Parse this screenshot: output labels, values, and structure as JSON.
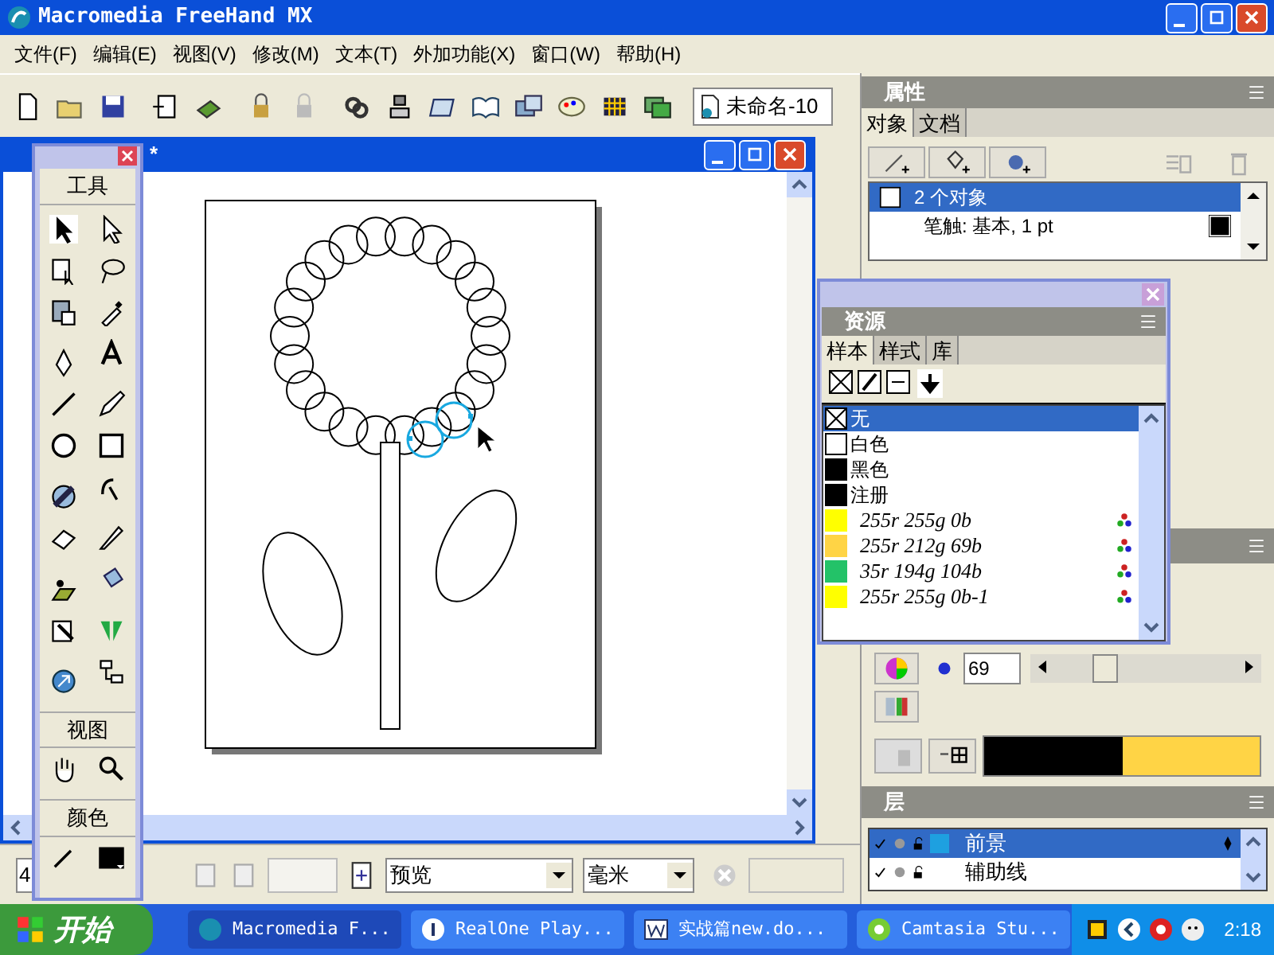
{
  "app": {
    "title": "Macromedia FreeHand MX"
  },
  "menu": [
    "文件(F)",
    "编辑(E)",
    "视图(V)",
    "修改(M)",
    "文本(T)",
    "外加功能(X)",
    "窗口(W)",
    "帮助(H)"
  ],
  "toolbar": {
    "document_name": "未命名-10"
  },
  "document": {
    "title": "*"
  },
  "toolbox": {
    "sections": [
      "工具",
      "视图",
      "颜色"
    ]
  },
  "properties": {
    "title": "属性",
    "tabs": [
      {
        "label": "对象",
        "selected": true
      },
      {
        "label": "文档",
        "selected": false
      }
    ],
    "items": [
      {
        "label": "2 个对象",
        "selected": true
      },
      {
        "label": "笔触: 基本, 1 pt",
        "selected": false
      }
    ]
  },
  "assets": {
    "title": "资源",
    "tabs": [
      {
        "label": "样本",
        "selected": true
      },
      {
        "label": "样式",
        "selected": false
      },
      {
        "label": "库",
        "selected": false
      }
    ],
    "swatches": [
      {
        "name": "无",
        "kind": "none",
        "selected": true
      },
      {
        "name": "白色",
        "kind": "named",
        "color": "#ffffff",
        "selected": false
      },
      {
        "name": "黑色",
        "kind": "named",
        "color": "#000000",
        "selected": false
      },
      {
        "name": "注册",
        "kind": "named",
        "color": "#000000",
        "selected": false
      },
      {
        "name": "255r 255g 0b",
        "kind": "process",
        "color": "#ffff00",
        "selected": false
      },
      {
        "name": "255r 212g 69b",
        "kind": "process",
        "color": "#ffd445",
        "selected": false
      },
      {
        "name": "35r 194g 104b",
        "kind": "process",
        "color": "#23c268",
        "selected": false
      },
      {
        "name": "255r 255g 0b-1",
        "kind": "process",
        "color": "#ffff00",
        "selected": false
      }
    ]
  },
  "mixer": {
    "blue_value": "69",
    "level": 0.3
  },
  "layers": {
    "title": "层",
    "items": [
      {
        "name": "前景",
        "selected": true,
        "visible": true,
        "color": "#1ea0e0"
      },
      {
        "name": "辅助线",
        "selected": false,
        "visible": true
      }
    ]
  },
  "status_bar": {
    "zoom": "4",
    "view_mode": "预览",
    "units": "毫米"
  },
  "taskbar": {
    "start": "开始",
    "tasks": [
      "Macromedia F...",
      "RealOne Play...",
      "实战篇new.do...",
      "Camtasia Stu..."
    ],
    "clock": "2:18"
  }
}
